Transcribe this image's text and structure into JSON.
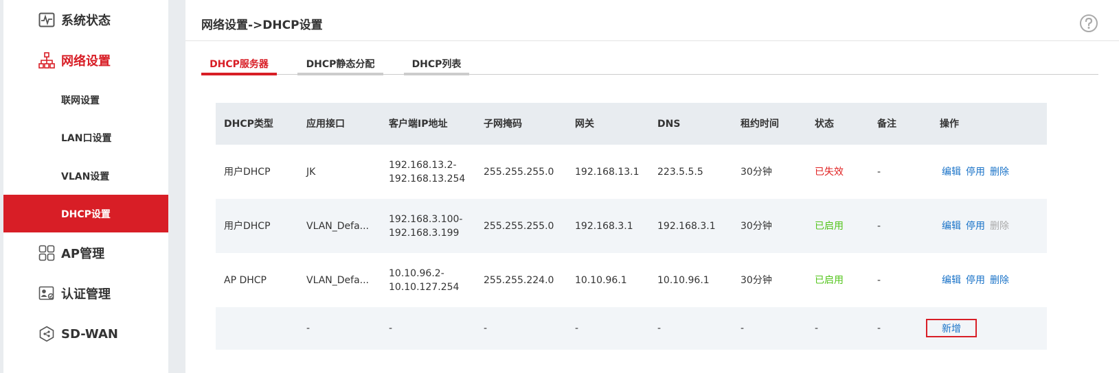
{
  "sidebar": {
    "items": [
      {
        "label": "系统状态",
        "icon": "pulse-monitor-icon"
      },
      {
        "label": "网络设置",
        "icon": "network-tree-icon"
      },
      {
        "label": "联网设置"
      },
      {
        "label": "LAN口设置"
      },
      {
        "label": "VLAN设置"
      },
      {
        "label": "DHCP设置"
      },
      {
        "label": "AP管理",
        "icon": "grid-squares-icon"
      },
      {
        "label": "认证管理",
        "icon": "id-card-icon"
      },
      {
        "label": "SD-WAN",
        "icon": "hexagon-network-icon"
      }
    ]
  },
  "header": {
    "title": "网络设置->DHCP设置",
    "help_icon": "question-circle-icon"
  },
  "tabs": [
    {
      "label": "DHCP服务器"
    },
    {
      "label": "DHCP静态分配"
    },
    {
      "label": "DHCP列表"
    }
  ],
  "table": {
    "headers": [
      "DHCP类型",
      "应用接口",
      "客户端IP地址",
      "子网掩码",
      "网关",
      "DNS",
      "租约时间",
      "状态",
      "备注",
      "操作"
    ],
    "rows": [
      {
        "type": "用户DHCP",
        "iface": "JK",
        "ip1": "192.168.13.2-",
        "ip2": "192.168.13.254",
        "mask": "255.255.255.0",
        "gateway": "192.168.13.1",
        "dns": "223.5.5.5",
        "lease": "30分钟",
        "status": "已失效",
        "note": "-",
        "ops": [
          "编辑",
          "停用",
          "删除"
        ]
      },
      {
        "type": "用户DHCP",
        "iface": "VLAN_Defa...",
        "ip1": "192.168.3.100-",
        "ip2": "192.168.3.199",
        "mask": "255.255.255.0",
        "gateway": "192.168.3.1",
        "dns": "192.168.3.1",
        "lease": "30分钟",
        "status": "已启用",
        "note": "-",
        "ops": [
          "编辑",
          "停用",
          "删除"
        ]
      },
      {
        "type": "AP DHCP",
        "iface": "VLAN_Defa...",
        "ip1": "10.10.96.2-",
        "ip2": "10.10.127.254",
        "mask": "255.255.224.0",
        "gateway": "10.10.96.1",
        "dns": "10.10.96.1",
        "lease": "30分钟",
        "status": "已启用",
        "note": "-",
        "ops": [
          "编辑",
          "停用",
          "删除"
        ]
      }
    ],
    "empty_row": [
      "-",
      "-",
      "-",
      "-",
      "-",
      "-",
      "-",
      "-"
    ],
    "add_label": "新增"
  },
  "colors": {
    "accent": "#d81e26",
    "link": "#1a73c8",
    "status_bad": "#e02020",
    "status_good": "#52c41a",
    "disabled": "#aaaaaa"
  }
}
